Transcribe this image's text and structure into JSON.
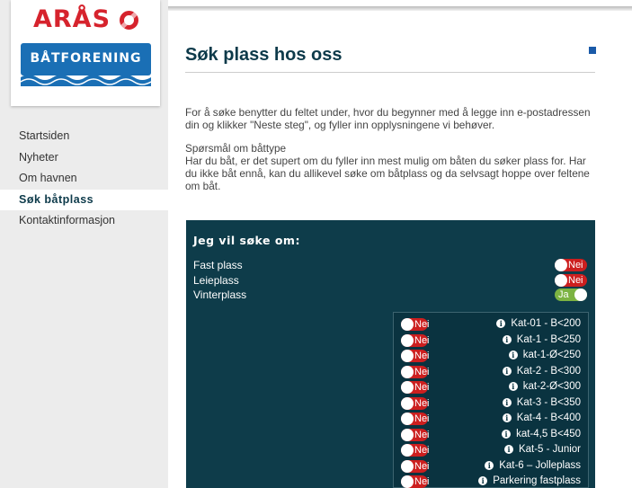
{
  "logo": {
    "top_text": "ARÅS",
    "banner_text": "BÅTFORENING"
  },
  "nav": [
    {
      "label": "Startsiden",
      "active": false
    },
    {
      "label": "Nyheter",
      "active": false
    },
    {
      "label": "Om havnen",
      "active": false
    },
    {
      "label": "Søk båtplass",
      "active": true
    },
    {
      "label": "Kontaktinformasjon",
      "active": false
    }
  ],
  "page": {
    "title": "Søk plass hos oss",
    "intro": "For å søke benytter du feltet under, hvor du begynner med å legge inn e-postadressen din og klikker \"Neste steg\", og fyller inn opplysningene vi behøver.",
    "question_title": "Spørsmål om båttype",
    "question_body": "Har du båt, er det supert om du fyller inn mest mulig om båten du søker plass for. Har du ikke båt ennå,  kan du allikevel søke om båtplass og da selvsagt hoppe over feltene om båt."
  },
  "form": {
    "heading": "Jeg vil søke om:",
    "options": [
      {
        "label": "Fast plass",
        "toggle": "Nei",
        "on": false
      },
      {
        "label": "Leieplass",
        "toggle": "Nei",
        "on": false
      },
      {
        "label": "Vinterplass",
        "toggle": "Ja",
        "on": true
      }
    ],
    "categories": [
      {
        "toggle": "Nei",
        "label": "Kat-01 - B<200"
      },
      {
        "toggle": "Nei",
        "label": "Kat-1 - B<250"
      },
      {
        "toggle": "Nei",
        "label": "kat-1-Ø<250"
      },
      {
        "toggle": "Nei",
        "label": "Kat-2 - B<300"
      },
      {
        "toggle": "Nei",
        "label": "kat-2-Ø<300"
      },
      {
        "toggle": "Nei",
        "label": "Kat-3 - B<350"
      },
      {
        "toggle": "Nei",
        "label": "Kat-4 - B<400"
      },
      {
        "toggle": "Nei",
        "label": "kat-4,5 B<450"
      },
      {
        "toggle": "Nei",
        "label": "Kat-5 - Junior"
      },
      {
        "toggle": "Nei",
        "label": "Kat-6 – Jolleplass"
      },
      {
        "toggle": "Nei",
        "label": "Parkering fastplass"
      }
    ]
  },
  "colors": {
    "brand_red": "#d6232d",
    "brand_blue": "#1a6fb5",
    "panel": "#0e3c4a",
    "toggle_off": "#cc1f1f",
    "toggle_on": "#7cb342"
  },
  "icons": {
    "info": "info-icon",
    "edit": "edit-icon",
    "lifebuoy": "lifebuoy-icon"
  }
}
